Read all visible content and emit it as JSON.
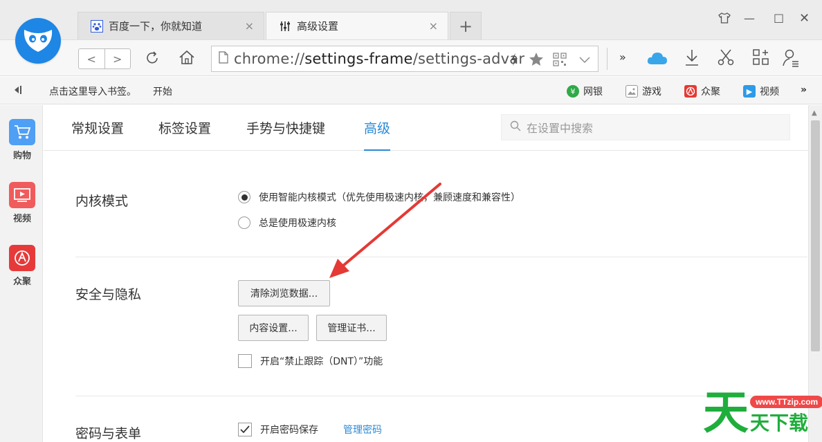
{
  "tabs": [
    {
      "title": "百度一下，你就知道",
      "close": "×"
    },
    {
      "title": "高级设置",
      "close": "×"
    }
  ],
  "new_tab": "+",
  "window_controls": {
    "skin": "♡",
    "minimize": "—",
    "maximize": "□",
    "close": "✕"
  },
  "toolbar": {
    "back": "<",
    "forward": ">",
    "url_scheme": "chrome://",
    "url_host": "settings-frame",
    "url_path": "/settings-advar",
    "more": "»",
    "icons": [
      "lightning-icon",
      "star-icon",
      "qr-code-icon",
      "chevron-down-icon",
      "cloud-icon",
      "download-icon",
      "scissors-icon",
      "apps-icon",
      "user-icon"
    ]
  },
  "bookmarks": {
    "import_text": "点击这里导入书签。",
    "start": "开始",
    "items": [
      {
        "label": "网银",
        "color": "#2faa48"
      },
      {
        "label": "游戏",
        "color": "#9e9e9e"
      },
      {
        "label": "众聚",
        "color": "#e53935"
      },
      {
        "label": "视频",
        "color": "#2c9be8"
      }
    ],
    "more": "»"
  },
  "sidebar": [
    {
      "label": "购物",
      "color": "#4f9ff5",
      "icon": "cart-icon"
    },
    {
      "label": "视频",
      "color": "#f05b5b",
      "icon": "video-icon"
    },
    {
      "label": "众聚",
      "color": "#e63a3a",
      "icon": "zhongju-icon"
    }
  ],
  "settings_nav": {
    "tabs": [
      "常规设置",
      "标签设置",
      "手势与快捷键",
      "高级"
    ],
    "active": "高级",
    "search_placeholder": "在设置中搜索"
  },
  "sections": {
    "kernel": {
      "title": "内核模式",
      "option1": "使用智能内核模式（优先使用极速内核，兼顾速度和兼容性）",
      "option2": "总是使用极速内核",
      "selected": "option1"
    },
    "privacy": {
      "title": "安全与隐私",
      "clear_data": "清除浏览数据...",
      "content_settings": "内容设置...",
      "manage_certs": "管理证书...",
      "dnt": "开启“禁止跟踪（DNT）”功能",
      "dnt_checked": false
    },
    "passwords": {
      "title": "密码与表单",
      "save_passwords": "开启密码保存",
      "save_checked": true,
      "manage": "管理密码"
    }
  },
  "watermark": {
    "url": "www.TTzip.com",
    "glyph": "天",
    "text": "天下载"
  },
  "colors": {
    "accent": "#2a8ad6",
    "annotation": "#e53935",
    "logo": "#1e86e5"
  }
}
